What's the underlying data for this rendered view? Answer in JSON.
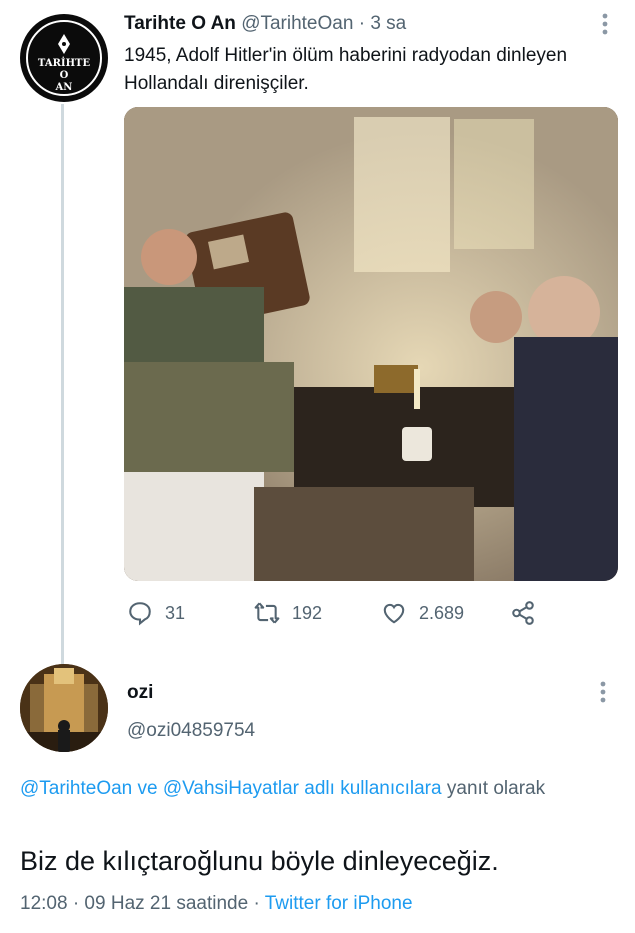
{
  "tweet": {
    "author_name": "Tarihte O An",
    "author_handle": "@TarihteOan",
    "separator": "·",
    "time": "3 sa",
    "text": "1945, Adolf Hitler'in ölüm haberini radyodan dinleyen Hollandalı direnişçiler.",
    "avatar_logo_top": "TARİHTE",
    "avatar_logo_mid": "O",
    "avatar_logo_bottom": "AN",
    "actions": {
      "replies": "31",
      "retweets": "192",
      "likes": "2.689"
    }
  },
  "reply": {
    "author_name": "ozi",
    "author_handle": "@ozi04859754",
    "replying_to": {
      "mentions": "@TarihteOan ve @VahsiHayatlar adlı kullanıcılara",
      "suffix": " yanıt olarak"
    },
    "text": "Biz de kılıçtaroğlunu böyle dinleyeceğiz.",
    "timestamp": "12:08 · 09 Haz 21 saatinde",
    "meta_separator": " · ",
    "source": "Twitter for iPhone"
  },
  "colors": {
    "accent": "#1d9bf0",
    "secondary_text": "#536471",
    "thread_line": "#cfd9de"
  },
  "icons": [
    "reply-icon",
    "retweet-icon",
    "like-icon",
    "share-icon",
    "more-icon"
  ]
}
